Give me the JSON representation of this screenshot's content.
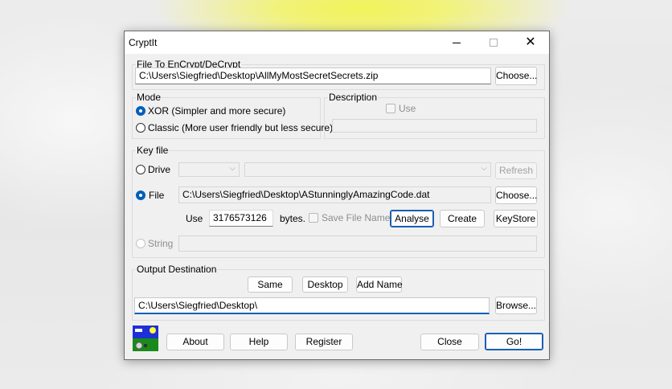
{
  "window": {
    "title": "CryptIt",
    "controls": {
      "minimize": "minimize-icon",
      "maximize": "maximize-icon",
      "close": "close-icon"
    }
  },
  "file_group": {
    "label": "File To EnCrypt/DeCrypt",
    "path": "C:\\Users\\Siegfried\\Desktop\\AllMyMostSecretSecrets.zip",
    "choose_label": "Choose..."
  },
  "mode_group": {
    "label": "Mode",
    "options": [
      {
        "label": "XOR (Simpler and more secure)",
        "selected": true
      },
      {
        "label": "Classic (More user friendly but less secure)",
        "selected": false
      }
    ]
  },
  "description_group": {
    "label": "Description",
    "use_label": "Use",
    "value": ""
  },
  "keyfile_group": {
    "label": "Key file",
    "drive": {
      "label": "Drive",
      "drive_value": "",
      "folder_value": "",
      "refresh_label": "Refresh"
    },
    "file": {
      "label": "File",
      "path": "C:\\Users\\Siegfried\\Desktop\\AStunninglyAmazingCode.dat",
      "choose_label": "Choose...",
      "use_label": "Use",
      "bytes_value": "3176573126",
      "bytes_label": "bytes.",
      "save_file_name_label": "Save File Name",
      "analyse_label": "Analyse",
      "create_label": "Create",
      "keystore_label": "KeyStore"
    },
    "string": {
      "label": "String",
      "value": ""
    }
  },
  "output_group": {
    "label": "Output Destination",
    "same_label": "Same",
    "desktop_label": "Desktop",
    "add_name_label": "Add Name",
    "path": "C:\\Users\\Siegfried\\Desktop\\",
    "browse_label": "Browse..."
  },
  "footer": {
    "logo_icon": "landscape-logo-icon",
    "about_label": "About",
    "help_label": "Help",
    "register_label": "Register",
    "close_label": "Close",
    "go_label": "Go!"
  },
  "colors": {
    "accent": "#005fb8",
    "default_button_border": "#1a5fb4",
    "window_bg": "#f0f0f0",
    "backdrop_highlight": "#f3f35a"
  }
}
